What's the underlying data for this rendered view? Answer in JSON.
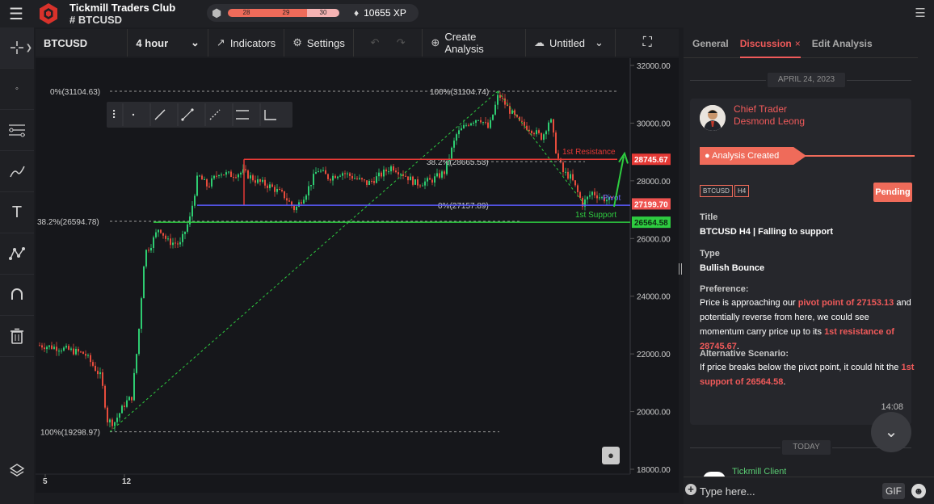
{
  "topbar": {
    "club_name": "Tickmill Traders Club",
    "symbol": "BTCUSD",
    "xp_levels": [
      "28",
      "29",
      "30"
    ],
    "xp_value": "10655 XP"
  },
  "chart_header": {
    "symbol": "BTCUSD",
    "timeframe": "4 hour",
    "indicators": "Indicators",
    "settings": "Settings",
    "create_analysis": "Create Analysis",
    "layout_name": "Untitled"
  },
  "chart_data": {
    "type": "candlestick",
    "title": "",
    "ylim": [
      18000,
      32000
    ],
    "yticks": [
      "32000.00",
      "30000.00",
      "28000.00",
      "26000.00",
      "24000.00",
      "22000.00",
      "20000.00",
      "18000.00"
    ],
    "xticks": [
      "5",
      "12"
    ],
    "price_badges": [
      {
        "label": "28745.67",
        "value": 28745.67,
        "color": "#e53935"
      },
      {
        "label": "27199.70",
        "value": 27199.7,
        "color": "#ef5350"
      },
      {
        "label": "26564.58",
        "value": 26564.58,
        "color": "#2ecc40"
      }
    ],
    "fib_top_left": {
      "label": "0%(31104.63)",
      "value": 31104.63
    },
    "fib_38_left": {
      "label": "38.2%(26594.78)",
      "value": 26594.78
    },
    "fib_100_left": {
      "label": "100%(19298.97)",
      "value": 19298.97
    },
    "fib_100_right": {
      "label": "100%(31104.74)",
      "value": 31104.74
    },
    "fib_38_right": {
      "label": "38.2%(28665.53)",
      "value": 28665.53
    },
    "fib_0_right": {
      "label": "0%(27157.89)",
      "value": 27157.89
    },
    "resistance": {
      "label": "1st Resistance",
      "value": 28745.67
    },
    "pivot": {
      "label": "Pivot",
      "value": 27153.13
    },
    "support": {
      "label": "1st Support",
      "value": 26564.58
    }
  },
  "panel": {
    "tabs": [
      "General",
      "Discussion",
      "Edit Analysis"
    ],
    "date_label": "APRIL 24, 2023",
    "author_role": "Chief Trader",
    "author_name": "Desmond Leong",
    "ribbon": "Analysis Created",
    "tags": [
      "BTCUSD",
      "H4"
    ],
    "status": "Pending",
    "title_label": "Title",
    "title_value": "BTCUSD H4 | Falling to support",
    "type_label": "Type",
    "type_value": "Bullish Bounce",
    "pref_label": "Preference:",
    "pref_1": "Price is approaching our ",
    "pref_2": "pivot point of 27153.13",
    "pref_3": " and potentially reverse from here, we could see momentum carry price up to its ",
    "pref_4": "1st resistance of 28745.67",
    "pref_5": ".",
    "alt_label": "Alternative Scenario:",
    "alt_1": "If price breaks below the pivot point, it could hit the ",
    "alt_2": "1st support of 26564.58",
    "alt_3": ".",
    "time": "14:08",
    "today": "TODAY",
    "next_author": "Tickmill Client",
    "input_placeholder": "Type here...",
    "gif": "GIF"
  }
}
